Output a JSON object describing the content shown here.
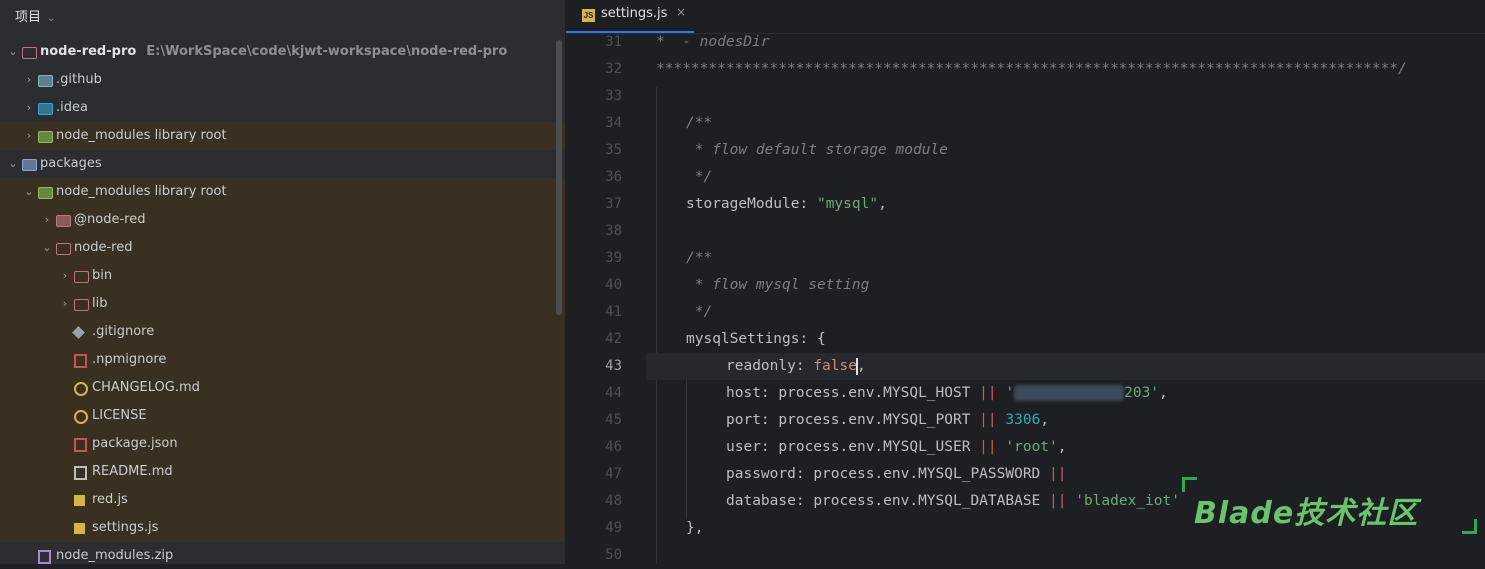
{
  "sidebar": {
    "title": "项目",
    "title_chevron": "⌄",
    "tree": [
      {
        "label": "node-red-pro",
        "sub": "E:\\WorkSpace\\code\\kjwt-workspace\\node-red-pro",
        "icon": "folder-icon",
        "arrow": "⌄"
      },
      {
        "label": ".github",
        "icon": "github-folder-icon",
        "arrow": "›"
      },
      {
        "label": ".idea",
        "icon": "idea-folder-icon",
        "arrow": "›"
      },
      {
        "label": "node_modules  library root",
        "icon": "node-modules-folder-icon",
        "arrow": "›"
      },
      {
        "label": "packages",
        "icon": "package-folder-icon",
        "arrow": "⌄"
      },
      {
        "label": "node_modules  library root",
        "icon": "node-modules-folder-icon",
        "arrow": "⌄"
      },
      {
        "label": "@node-red",
        "icon": "folder-icon",
        "arrow": "›"
      },
      {
        "label": "node-red",
        "icon": "folder-icon",
        "arrow": "⌄"
      },
      {
        "label": "bin",
        "icon": "folder-icon",
        "arrow": "›"
      },
      {
        "label": "lib",
        "icon": "folder-icon",
        "arrow": "›"
      },
      {
        "label": ".gitignore",
        "icon": "git-icon"
      },
      {
        "label": ".npmignore",
        "icon": "npm-icon"
      },
      {
        "label": "CHANGELOG.md",
        "icon": "clock-icon"
      },
      {
        "label": "LICENSE",
        "icon": "copyright-icon"
      },
      {
        "label": "package.json",
        "icon": "npm-icon"
      },
      {
        "label": "README.md",
        "icon": "book-icon"
      },
      {
        "label": "red.js",
        "icon": "js-file-icon"
      },
      {
        "label": "settings.js",
        "icon": "js-file-icon"
      },
      {
        "label": "node_modules.zip",
        "icon": "zip-icon"
      }
    ]
  },
  "editor": {
    "tab": {
      "label": "settings.js",
      "icon_text": "JS",
      "close": "×"
    },
    "line_numbers": [
      "31",
      "32",
      "33",
      "34",
      "35",
      "36",
      "37",
      "38",
      "39",
      "40",
      "41",
      "42",
      "43",
      "44",
      "45",
      "46",
      "47",
      "48",
      "49",
      "50"
    ],
    "lines": {
      "l31": "*  - nodesDir",
      "l32": "*************************************************************************************/",
      "l34": "/**",
      "l35": " * flow default storage module",
      "l36": " */",
      "l37_key": "storageModule",
      "l37_val": "\"mysql\"",
      "l39": "/**",
      "l40": " * flow mysql setting",
      "l41": " */",
      "l42_key": "mysqlSettings",
      "l43_key": "readonly",
      "l43_val": "false",
      "l44_key": "host",
      "l44_expr": "process.env.MYSQL_HOST",
      "l44_val_tail": "203'",
      "l45_key": "port",
      "l45_expr": "process.env.MYSQL_PORT",
      "l45_val": "3306",
      "l46_key": "user",
      "l46_expr": "process.env.MYSQL_USER",
      "l46_val": "'root'",
      "l47_key": "password",
      "l47_expr": "process.env.MYSQL_PASSWORD",
      "l48_key": "database",
      "l48_expr": "process.env.MYSQL_DATABASE",
      "l48_val": "'bladex_iot'",
      "l49": "},"
    },
    "watermark": "Blade技术社区"
  }
}
